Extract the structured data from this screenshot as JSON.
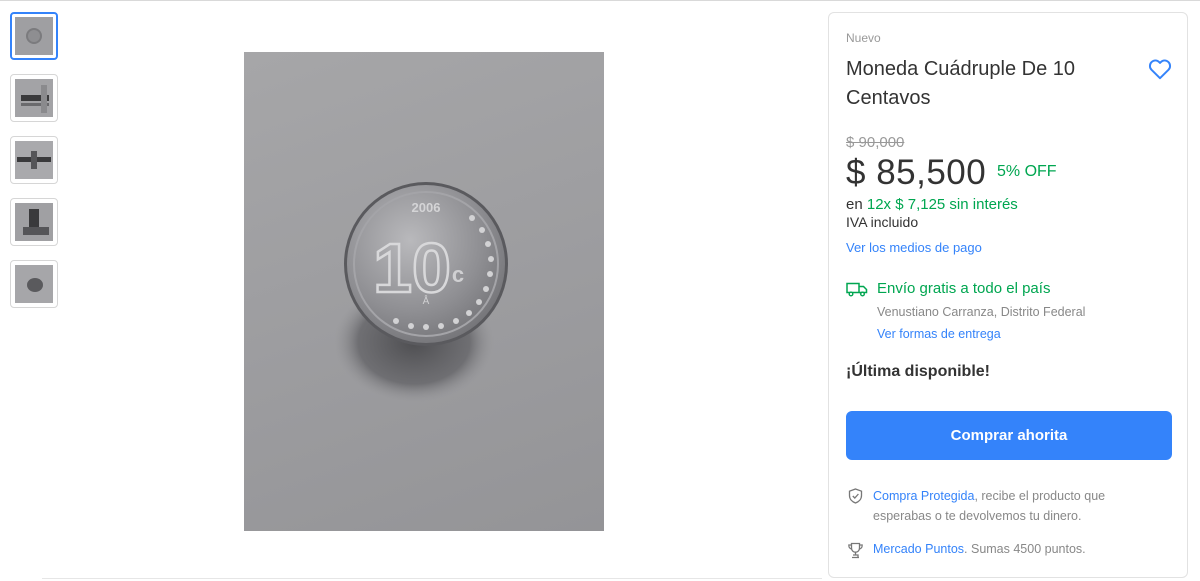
{
  "gallery": {
    "thumbnails": [
      {
        "alt": "coin-front",
        "selected": true
      },
      {
        "alt": "coin-side-1",
        "selected": false
      },
      {
        "alt": "coin-edge",
        "selected": false
      },
      {
        "alt": "coin-standing",
        "selected": false
      },
      {
        "alt": "coin-side-2",
        "selected": false
      }
    ],
    "coin": {
      "year": "2006",
      "value": "10",
      "unit": "c",
      "mint": "Å"
    }
  },
  "product": {
    "condition": "Nuevo",
    "title": "Moneda Cuádruple De 10 Centavos",
    "original_price": "$ 90,000",
    "price": "$ 85,500",
    "discount": "5% OFF",
    "installments_prefix": "en",
    "installments": "12x $ 7,125 sin interés",
    "tax_note": "IVA incluido",
    "payment_link": "Ver los medios de pago",
    "shipping": "Envío gratis a todo el país",
    "location": "Venustiano Carranza, Distrito Federal",
    "delivery_link": "Ver formas de entrega",
    "stock": "¡Última disponible!",
    "buy_button": "Comprar ahorita",
    "protection_link": "Compra Protegida",
    "protection_text": ", recibe el producto que esperabas o te devolvemos tu dinero.",
    "points_link": "Mercado Puntos",
    "points_text": ". Sumas 4500 puntos."
  },
  "icons": {
    "favorite": "heart-icon",
    "shipping": "truck-icon",
    "protection": "shield-icon",
    "points": "trophy-icon"
  },
  "colors": {
    "accent": "#3483fa",
    "success": "#00a650",
    "muted": "#999999",
    "text": "#333333"
  }
}
